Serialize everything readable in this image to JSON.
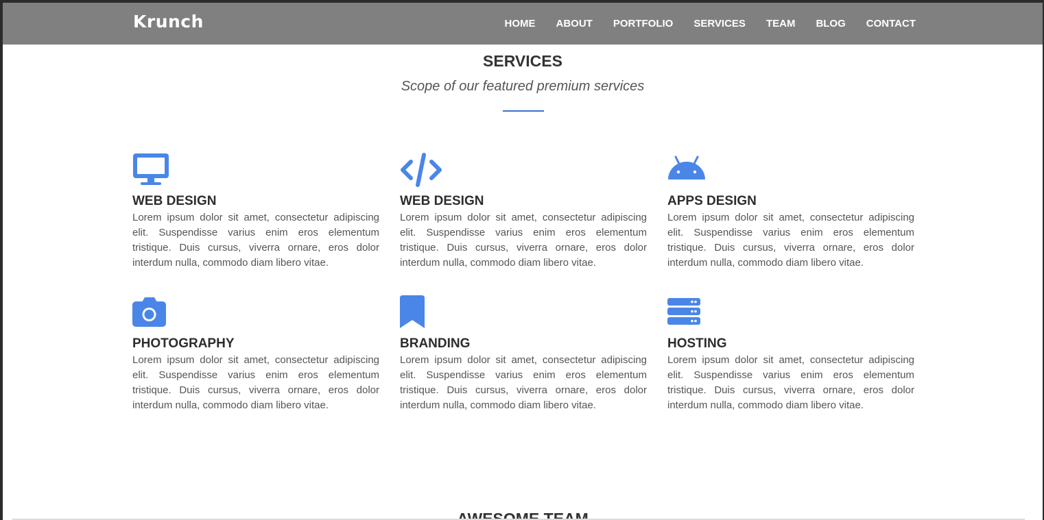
{
  "brand": "Krunch",
  "nav": {
    "items": [
      "HOME",
      "ABOUT",
      "PORTFOLIO",
      "SERVICES",
      "TEAM",
      "BLOG",
      "CONTACT"
    ]
  },
  "services_section": {
    "title": "SERVICES",
    "subtitle": "Scope of our featured premium services",
    "accent_color": "#4a86e8",
    "items": [
      {
        "icon": "monitor-icon",
        "title": "WEB DESIGN",
        "text": "Lorem ipsum dolor sit amet, consectetur adipiscing elit. Suspendisse varius enim eros elementum tristique. Duis cursus, viverra ornare, eros dolor interdum nulla, commodo diam libero vitae."
      },
      {
        "icon": "code-icon",
        "title": "WEB DESIGN",
        "text": "Lorem ipsum dolor sit amet, consectetur adipiscing elit. Suspendisse varius enim eros elementum tristique. Duis cursus, viverra ornare, eros dolor interdum nulla, commodo diam libero vitae."
      },
      {
        "icon": "android-icon",
        "title": "APPS DESIGN",
        "text": "Lorem ipsum dolor sit amet, consectetur adipiscing elit. Suspendisse varius enim eros elementum tristique. Duis cursus, viverra ornare, eros dolor interdum nulla, commodo diam libero vitae."
      },
      {
        "icon": "camera-icon",
        "title": "PHOTOGRAPHY",
        "text": "Lorem ipsum dolor sit amet, consectetur adipiscing elit. Suspendisse varius enim eros elementum tristique. Duis cursus, viverra ornare, eros dolor interdum nulla, commodo diam libero vitae."
      },
      {
        "icon": "bookmark-icon",
        "title": "BRANDING",
        "text": "Lorem ipsum dolor sit amet, consectetur adipiscing elit. Suspendisse varius enim eros elementum tristique. Duis cursus, viverra ornare, eros dolor interdum nulla, commodo diam libero vitae."
      },
      {
        "icon": "server-icon",
        "title": "HOSTING",
        "text": "Lorem ipsum dolor sit amet, consectetur adipiscing elit. Suspendisse varius enim eros elementum tristique. Duis cursus, viverra ornare, eros dolor interdum nulla, commodo diam libero vitae."
      }
    ]
  },
  "next_section": {
    "title": "AWESOME TEAM"
  }
}
